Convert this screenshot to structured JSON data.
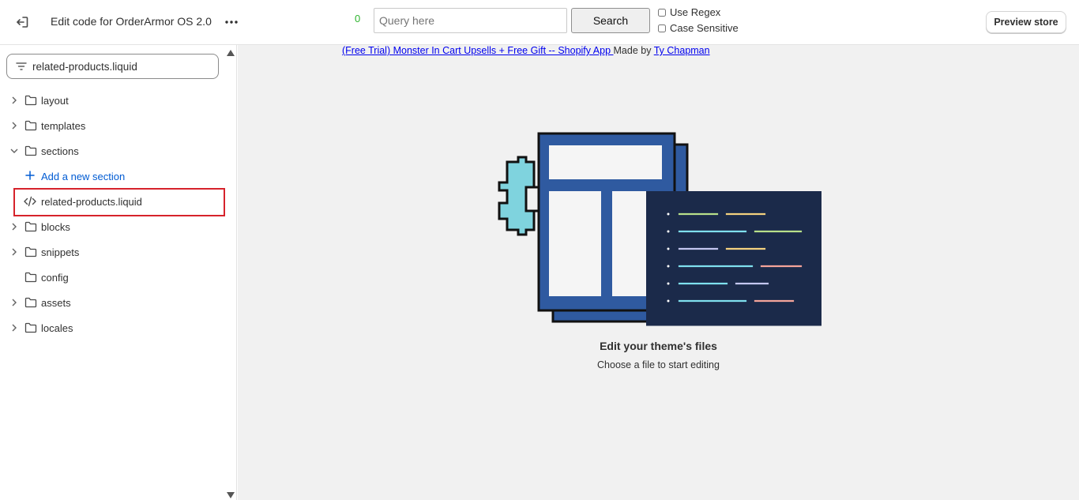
{
  "topbar": {
    "title": "Edit code for OrderArmor OS 2.0",
    "match_count": "0",
    "query_placeholder": "Query here",
    "search_label": "Search",
    "use_regex_label": "Use Regex",
    "case_sensitive_label": "Case Sensitive",
    "preview_label": "Preview store"
  },
  "sidebar": {
    "filter_value": "related-products.liquid",
    "items": [
      {
        "label": "layout",
        "type": "folder",
        "expanded": false
      },
      {
        "label": "templates",
        "type": "folder",
        "expanded": false
      },
      {
        "label": "sections",
        "type": "folder",
        "expanded": true
      },
      {
        "label": "Add a new section",
        "type": "add"
      },
      {
        "label": "related-products.liquid",
        "type": "file",
        "selected": true
      },
      {
        "label": "blocks",
        "type": "folder",
        "expanded": false
      },
      {
        "label": "snippets",
        "type": "folder",
        "expanded": false
      },
      {
        "label": "config",
        "type": "folder",
        "expanded": false
      },
      {
        "label": "assets",
        "type": "folder",
        "expanded": false
      },
      {
        "label": "locales",
        "type": "folder",
        "expanded": false
      }
    ]
  },
  "main": {
    "promo_link": "(Free Trial) Monster In Cart Upsells + Free Gift -- Shopify App ",
    "promo_made_by": "Made by ",
    "promo_author": "Ty Chapman",
    "empty_title": "Edit your theme's files",
    "empty_subtitle": "Choose a file to start editing"
  },
  "colors": {
    "accent_link": "#005bd3",
    "match_count": "#2fb52f",
    "highlight": "#d6232b",
    "illustration_blue": "#2f5aa0",
    "illustration_navy": "#1b2a4a",
    "illustration_cyan": "#7fd3de"
  },
  "icons": {
    "exit": "exit-icon",
    "more": "more-horizontal-icon",
    "filter": "filter-icon",
    "chevron_right": "chevron-right-icon",
    "chevron_down": "chevron-down-icon",
    "folder": "folder-icon",
    "plus": "plus-icon",
    "code": "code-icon"
  }
}
